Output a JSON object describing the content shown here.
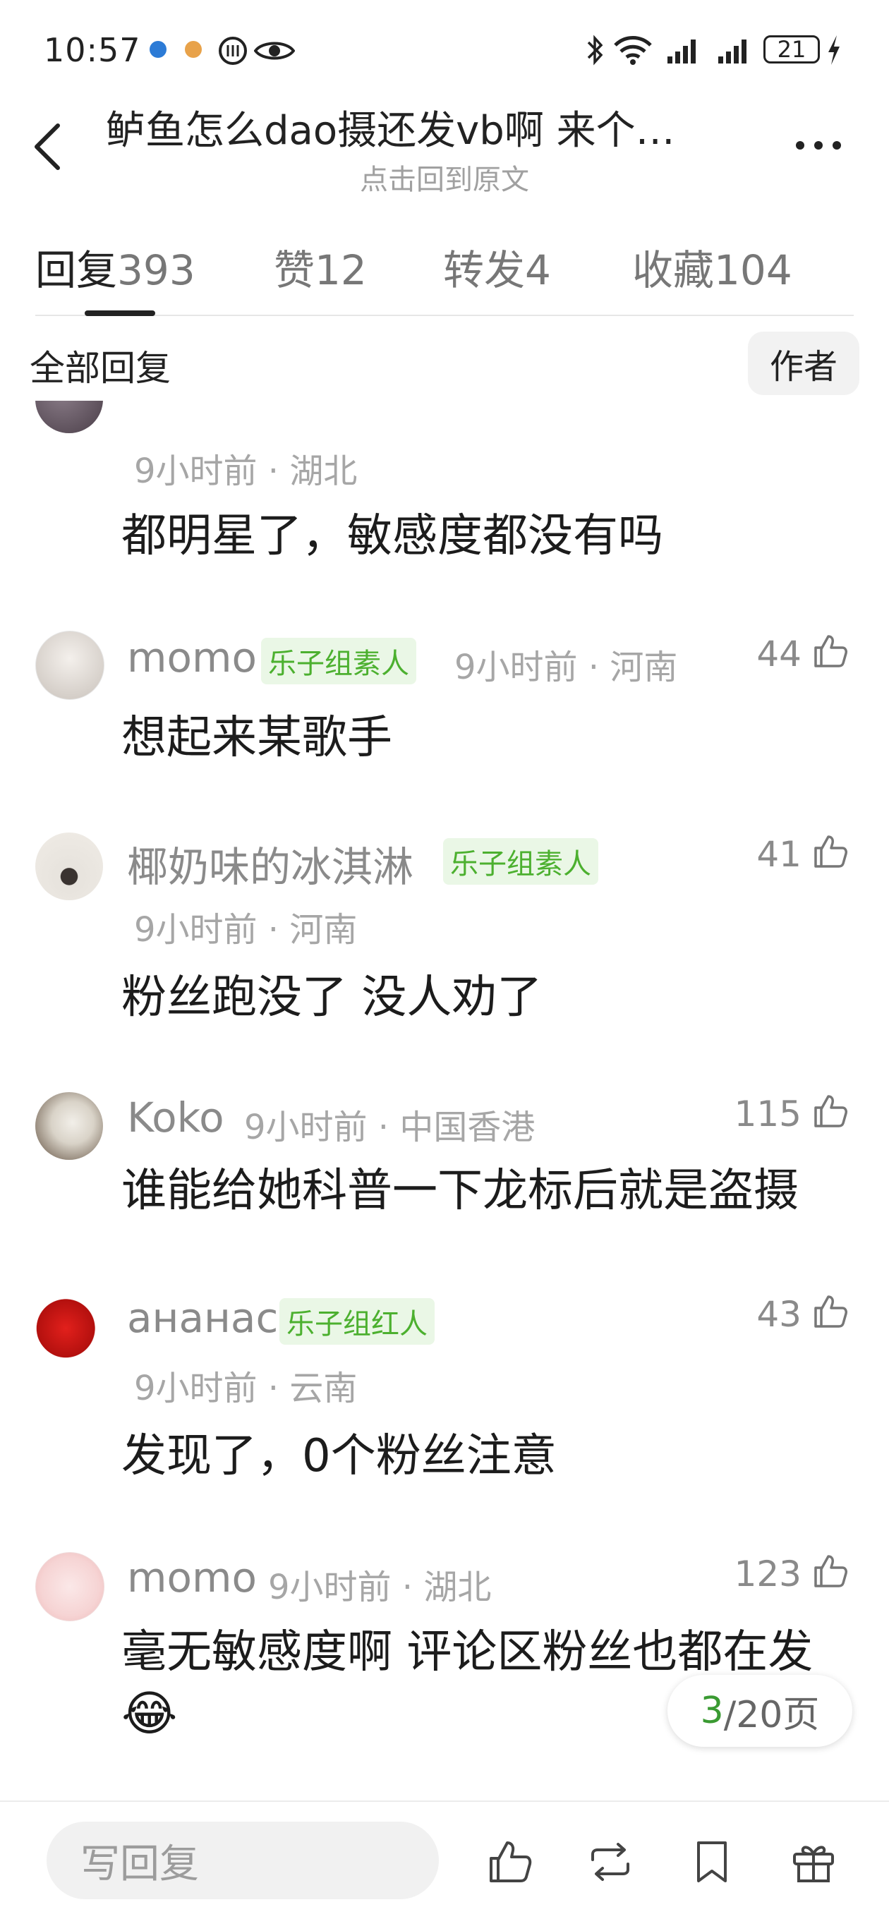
{
  "status_bar": {
    "time": "10:57",
    "battery": "21",
    "icons": [
      "app-notif-icon",
      "app-notif-icon",
      "nfc-icon",
      "eye-icon",
      "bluetooth-icon",
      "wifi-icon",
      "signal-icon",
      "signal-icon",
      "battery-icon",
      "charging-icon"
    ]
  },
  "header": {
    "title": "鲈鱼怎么dao摄还发vb啊 来个…",
    "subtitle": "点击回到原文"
  },
  "tabs": [
    {
      "label": "回复",
      "count": "393"
    },
    {
      "label": "赞",
      "count": "12"
    },
    {
      "label": "转发",
      "count": "4"
    },
    {
      "label": "收藏",
      "count": "104"
    }
  ],
  "filter": {
    "all": "全部回复",
    "author": "作者"
  },
  "comments": [
    {
      "username": "",
      "badge": "",
      "time": "9小时前 · 湖北",
      "likes": "",
      "text": "都明星了，敏感度都没有吗"
    },
    {
      "username": "momo",
      "badge": "乐子组素人",
      "time": "9小时前 · 河南",
      "likes": "44",
      "text": "想起来某歌手"
    },
    {
      "username": "椰奶味的冰淇淋",
      "badge": "乐子组素人",
      "time": "9小时前 · 河南",
      "likes": "41",
      "text": "粉丝跑没了 没人劝了"
    },
    {
      "username": "Koko",
      "badge": "",
      "time": "9小时前 · 中国香港",
      "likes": "115",
      "text": "谁能给她科普一下龙标后就是盗摄"
    },
    {
      "username": "ананас",
      "badge": "乐子组红人",
      "time": "9小时前 · 云南",
      "likes": "43",
      "text": "发现了，0个粉丝注意"
    },
    {
      "username": "momo",
      "badge": "",
      "time": "9小时前 · 湖北",
      "likes": "123",
      "text": "毫无敏感度啊 评论区粉丝也都在发",
      "emoji": "😂"
    }
  ],
  "pager": {
    "current": "3",
    "total": "/20页"
  },
  "bottom_bar": {
    "reply_placeholder": "写回复"
  },
  "colors": {
    "accent_green": "#4cb02f",
    "badge_bg": "#eaf7e6"
  }
}
